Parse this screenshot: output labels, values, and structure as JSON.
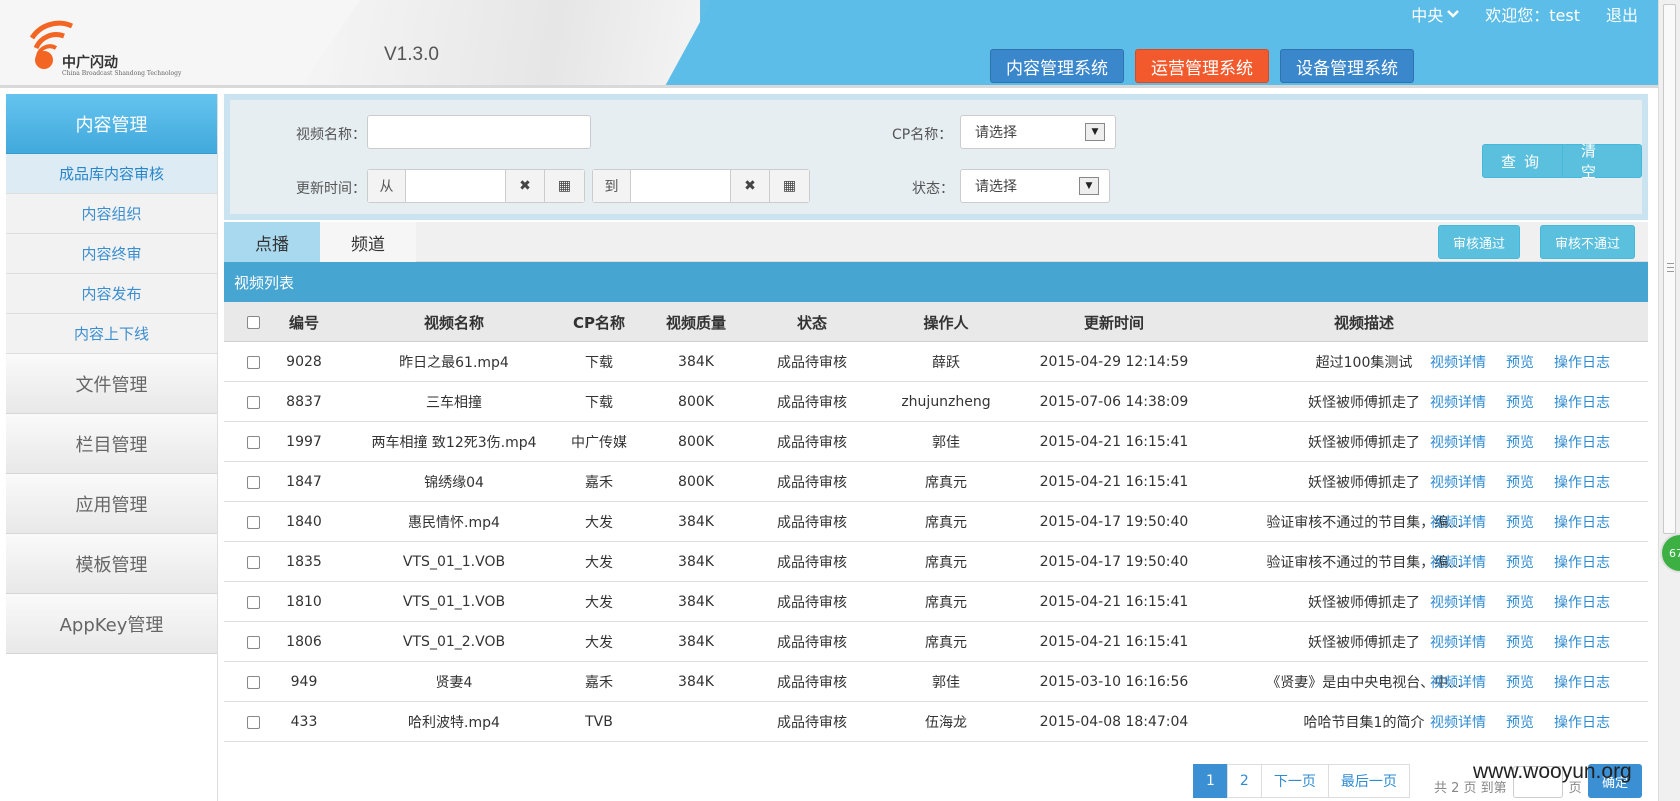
{
  "header": {
    "logo_cn": "中广闪动",
    "logo_en": "China Broadcast Shandong Technology",
    "version": "V1.3.0",
    "region": "中央",
    "welcome": "欢迎您：test",
    "logout": "退出",
    "systems": [
      "内容管理系统",
      "运营管理系统",
      "设备管理系统"
    ],
    "accent_color": "#5bbde8",
    "active_system_color": "#f25a2d"
  },
  "sidebar": {
    "title": "内容管理",
    "sub_items": [
      "成品库内容审核",
      "内容组织",
      "内容终审",
      "内容发布",
      "内容上下线"
    ],
    "active_sub": "成品库内容审核",
    "main_items": [
      "文件管理",
      "栏目管理",
      "应用管理",
      "模板管理",
      "AppKey管理"
    ]
  },
  "search": {
    "video_name_label": "视频名称：",
    "video_name_value": "",
    "cp_label": "CP名称：",
    "cp_value": "请选择",
    "update_time_label": "更新时间：",
    "from_label": "从",
    "to_label": "到",
    "status_label": "状态：",
    "status_value": "请选择",
    "query_button": "查询",
    "clear_button": "清空"
  },
  "tabs": {
    "items": [
      "点播",
      "频道"
    ],
    "active": "点播",
    "approve_button": "审核通过",
    "reject_button": "审核不通过"
  },
  "list": {
    "title": "视频列表",
    "columns": [
      "编号",
      "视频名称",
      "CP名称",
      "视频质量",
      "状态",
      "操作人",
      "更新时间",
      "视频描述"
    ],
    "actions": [
      "视频详情",
      "预览",
      "操作日志"
    ],
    "rows": [
      {
        "id": "9028",
        "name": "昨日之最61.mp4",
        "cp": "下载",
        "quality": "384K",
        "status": "成品待审核",
        "operator": "薛跃",
        "time": "2015-04-29 12:14:59",
        "desc": "超过100集测试"
      },
      {
        "id": "8837",
        "name": "三车相撞",
        "cp": "下载",
        "quality": "800K",
        "status": "成品待审核",
        "operator": "zhujunzheng",
        "time": "2015-07-06 14:38:09",
        "desc": "妖怪被师傅抓走了"
      },
      {
        "id": "1997",
        "name": "两车相撞 致12死3伤.mp4",
        "cp": "中广传媒",
        "quality": "800K",
        "status": "成品待审核",
        "operator": "郭佳",
        "time": "2015-04-21 16:15:41",
        "desc": "妖怪被师傅抓走了"
      },
      {
        "id": "1847",
        "name": "锦绣缘04",
        "cp": "嘉禾",
        "quality": "800K",
        "status": "成品待审核",
        "operator": "席真元",
        "time": "2015-04-21 16:15:41",
        "desc": "妖怪被师傅抓走了"
      },
      {
        "id": "1840",
        "name": "惠民情怀.mp4",
        "cp": "大发",
        "quality": "384K",
        "status": "成品待审核",
        "operator": "席真元",
        "time": "2015-04-17 19:50:40",
        "desc": "验证审核不通过的节目集，编..."
      },
      {
        "id": "1835",
        "name": "VTS_01_1.VOB",
        "cp": "大发",
        "quality": "384K",
        "status": "成品待审核",
        "operator": "席真元",
        "time": "2015-04-17 19:50:40",
        "desc": "验证审核不通过的节目集，编..."
      },
      {
        "id": "1810",
        "name": "VTS_01_1.VOB",
        "cp": "大发",
        "quality": "384K",
        "status": "成品待审核",
        "operator": "席真元",
        "time": "2015-04-21 16:15:41",
        "desc": "妖怪被师傅抓走了"
      },
      {
        "id": "1806",
        "name": "VTS_01_2.VOB",
        "cp": "大发",
        "quality": "384K",
        "status": "成品待审核",
        "operator": "席真元",
        "time": "2015-04-21 16:15:41",
        "desc": "妖怪被师傅抓走了"
      },
      {
        "id": "949",
        "name": "贤妻4",
        "cp": "嘉禾",
        "quality": "384K",
        "status": "成品待审核",
        "operator": "郭佳",
        "time": "2015-03-10 16:16:56",
        "desc": "《贤妻》是由中央电视台、中..."
      },
      {
        "id": "433",
        "name": "哈利波特.mp4",
        "cp": "TVB",
        "quality": "",
        "status": "成品待审核",
        "operator": "伍海龙",
        "time": "2015-04-08 18:47:04",
        "desc": "哈哈节目集1的简介"
      }
    ]
  },
  "pagination": {
    "pages": [
      "1",
      "2"
    ],
    "current": "1",
    "next": "下一页",
    "last": "最后一页",
    "total_text": "共 2 页 到第",
    "page_unit": "页",
    "confirm": "确定"
  },
  "float_badge": "67",
  "watermark": "www.wooyun.org"
}
